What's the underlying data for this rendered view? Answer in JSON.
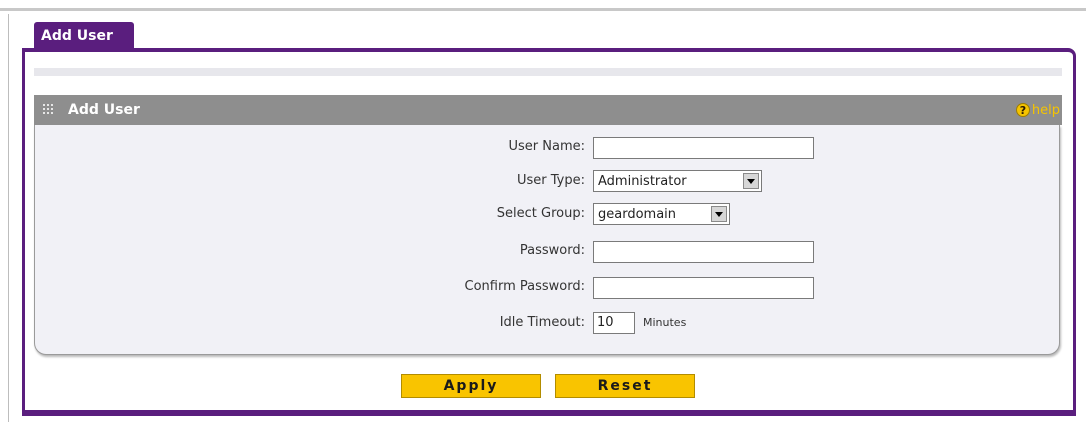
{
  "tab": {
    "label": "Add User"
  },
  "section": {
    "title": "Add User",
    "help_label": "help",
    "help_icon": "question-icon"
  },
  "form": {
    "user_name": {
      "label": "User Name:",
      "value": ""
    },
    "user_type": {
      "label": "User Type:",
      "value": "Administrator"
    },
    "select_group": {
      "label": "Select Group:",
      "value": "geardomain"
    },
    "password": {
      "label": "Password:",
      "value": ""
    },
    "confirm_password": {
      "label": "Confirm Password:",
      "value": ""
    },
    "idle_timeout": {
      "label": "Idle Timeout:",
      "value": "10",
      "unit": "Minutes"
    }
  },
  "buttons": {
    "apply": "Apply",
    "reset": "Reset"
  },
  "colors": {
    "accent": "#5a1e7e",
    "header": "#8e8e8e",
    "button": "#f9c400",
    "help": "#f5c400"
  }
}
